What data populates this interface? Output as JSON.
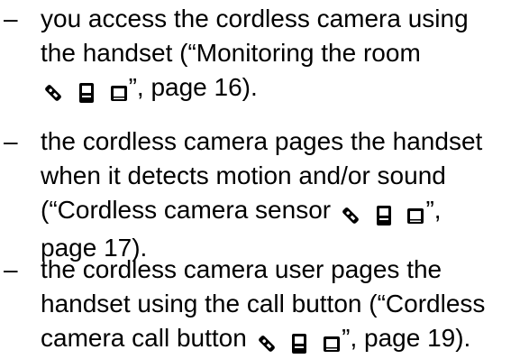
{
  "list": {
    "bullet": "–",
    "items": [
      {
        "lines": [
          "you access the cordless camera using",
          "the handset (“Monitoring the room",
          "”, page 16)."
        ]
      },
      {
        "lines": [
          "the cordless camera pages the handset",
          "when it detects motion and/or sound",
          "(“Cordless camera sensor",
          "”,",
          "page 17)."
        ]
      },
      {
        "lines": [
          "the cordless camera user pages the",
          "handset using the call button (“Cordless",
          "camera call button",
          "”, page 19)."
        ]
      }
    ]
  },
  "icons": [
    "remote-icon",
    "handset-icon",
    "camera-icon"
  ]
}
